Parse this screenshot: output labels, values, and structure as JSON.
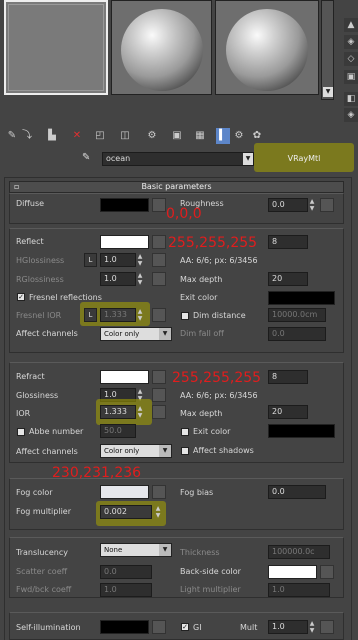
{
  "top_sidebar": [
    "▲",
    "◈",
    "◇",
    "▣",
    "◧",
    "◈",
    "▼"
  ],
  "material": {
    "name": "ocean",
    "type": "VRayMtl"
  },
  "rollout_title": "Basic parameters",
  "diffuse": {
    "label": "Diffuse",
    "roughness_label": "Roughness",
    "roughness": "0.0",
    "color": "#000000"
  },
  "reflect": {
    "label": "Reflect",
    "color": "#ffffff",
    "hgloss_label": "HGlossiness",
    "hgloss": "1.0",
    "rgloss_label": "RGlossiness",
    "rgloss": "1.0",
    "fresnel_label": "Fresnel reflections",
    "fresnel_ior_label": "Fresnel IOR",
    "fresnel_ior": "1.333",
    "affect_label": "Affect channels",
    "affect": "Color only",
    "subdivs": "8",
    "aa_text": "AA: 6/6; px: 6/3456",
    "maxdepth_label": "Max depth",
    "maxdepth": "20",
    "exit_label": "Exit color",
    "dimdist_label": "Dim distance",
    "dimdist": "10000.0cm",
    "dimfall_label": "Dim fall off",
    "dimfall": "0.0"
  },
  "refract": {
    "label": "Refract",
    "color": "#ffffff",
    "gloss_label": "Glossiness",
    "gloss": "1.0",
    "ior_label": "IOR",
    "ior": "1.333",
    "abbe_label": "Abbe number",
    "abbe": "50.0",
    "affect_label": "Affect channels",
    "affect": "Color only",
    "subdivs": "8",
    "aa_text": "AA: 6/6; px: 6/3456",
    "maxdepth_label": "Max depth",
    "maxdepth": "20",
    "exit_label": "Exit color",
    "shadows_label": "Affect shadows"
  },
  "fog": {
    "color_label": "Fog color",
    "color": "#e6e7ec",
    "mult_label": "Fog multiplier",
    "mult": "0.002",
    "bias_label": "Fog bias",
    "bias": "0.0"
  },
  "translucency": {
    "label": "Translucency",
    "mode": "None",
    "scatter_label": "Scatter coeff",
    "scatter": "0.0",
    "fwd_label": "Fwd/bck coeff",
    "fwd": "1.0",
    "thickness_label": "Thickness",
    "thickness": "100000.0c",
    "back_label": "Back-side color",
    "light_label": "Light multiplier",
    "light": "1.0"
  },
  "selfillum": {
    "label": "Self-illumination",
    "gi_label": "GI",
    "mult_label": "Mult",
    "mult": "1.0"
  },
  "annotations": {
    "diffuse": "0,0,0",
    "reflect": "255,255,255",
    "refract": "255,255,255",
    "fog": "230,231,236"
  }
}
